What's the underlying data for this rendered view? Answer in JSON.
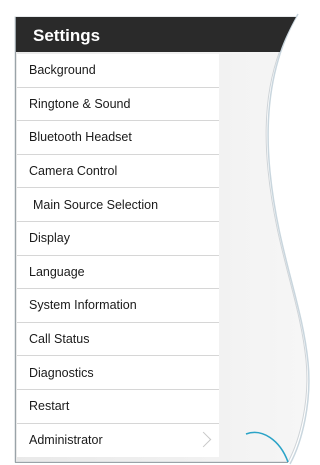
{
  "header": {
    "title": "Settings"
  },
  "menu": {
    "items": [
      {
        "label": "Background"
      },
      {
        "label": "Ringtone & Sound"
      },
      {
        "label": "Bluetooth Headset"
      },
      {
        "label": "Camera Control"
      },
      {
        "label": "Main Source Selection"
      },
      {
        "label": "Display"
      },
      {
        "label": "Language"
      },
      {
        "label": "System Information"
      },
      {
        "label": "Call Status"
      },
      {
        "label": "Diagnostics"
      },
      {
        "label": "Restart"
      },
      {
        "label": "Administrator"
      }
    ]
  },
  "colors": {
    "header_bg": "#2a2a2a",
    "panel_bg": "#ececec",
    "accent_line": "#2aa3c7",
    "text": "#1a1a1a"
  },
  "icons": {
    "more": "chevron-right-icon"
  }
}
